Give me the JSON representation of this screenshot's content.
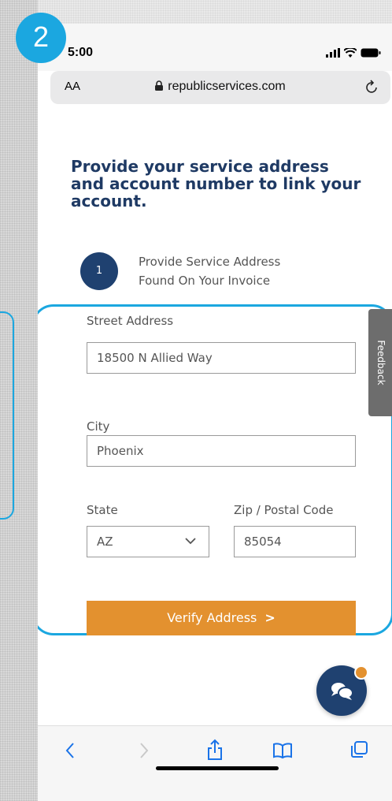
{
  "tutorial": {
    "step_badge": "2"
  },
  "status_bar": {
    "time": "5:00"
  },
  "browser": {
    "text_size_label": "AA",
    "url": "republicservices.com"
  },
  "page": {
    "heading": "Provide your service address and account number to link your account.",
    "step": {
      "number": "1",
      "line1": "Provide Service Address",
      "line2": "Found On Your Invoice"
    }
  },
  "form": {
    "street_label": "Street Address",
    "street_value": "18500 N Allied Way",
    "city_label": "City",
    "city_value": "Phoenix",
    "state_label": "State",
    "state_value": "AZ",
    "zip_label": "Zip / Postal Code",
    "zip_value": "85054",
    "verify_button": "Verify Address",
    "verify_chevron": ">"
  },
  "feedback": {
    "label": "Feedback"
  },
  "colors": {
    "brand_navy": "#1f4170",
    "accent_orange": "#e3912f",
    "highlight_blue": "#1ba7e0"
  },
  "toolbar_icons": [
    "back-arrow-icon",
    "forward-arrow-icon",
    "share-icon",
    "bookmarks-icon",
    "tabs-icon"
  ]
}
